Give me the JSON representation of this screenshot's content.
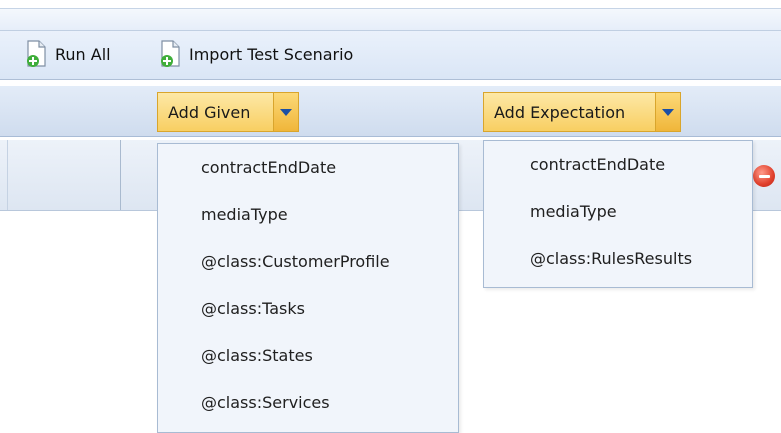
{
  "toolbar": {
    "run_all_label": "Run All",
    "import_label": "Import Test Scenario",
    "icon": "add-document-icon"
  },
  "add_bar": {
    "given_label": "Add Given",
    "expectation_label": "Add Expectation"
  },
  "given_menu": {
    "items": [
      "contractEndDate",
      "mediaType",
      "@class:CustomerProfile",
      "@class:Tasks",
      "@class:States",
      "@class:Services"
    ]
  },
  "expectation_menu": {
    "items": [
      "contractEndDate",
      "mediaType",
      "@class:RulesResults"
    ]
  },
  "colors": {
    "toolbar_bg": "#dae6f6",
    "button_accent": "#f8cf62",
    "arrow_color": "#1b4fa5",
    "menu_bg": "#f1f5fb",
    "remove_icon": "#e0402c"
  }
}
